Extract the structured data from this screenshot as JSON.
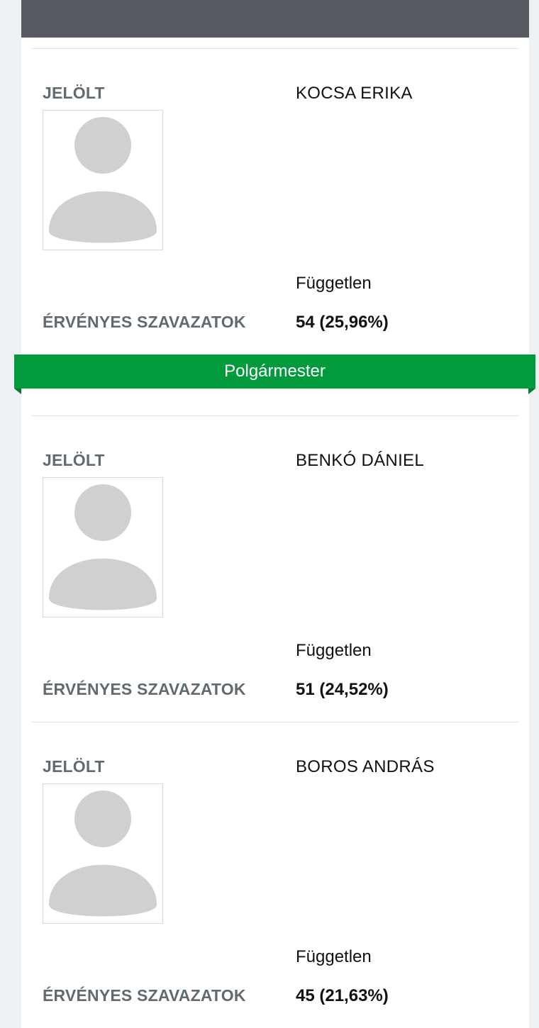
{
  "section_banner": "Polgármester",
  "labels": {
    "candidate": "JELÖLT",
    "valid_votes": "ÉRVÉNYES SZAVAZATOK"
  },
  "candidates": [
    {
      "name": "KOCSA ERIKA",
      "party": "Független",
      "votes": "54 (25,96%)"
    },
    {
      "name": "BENKÓ DÁNIEL",
      "party": "Független",
      "votes": "51 (24,52%)"
    },
    {
      "name": "BOROS ANDRÁS",
      "party": "Független",
      "votes": "45 (21,63%)"
    }
  ],
  "colors": {
    "banner": "#039a3e",
    "top_bar": "#555b61",
    "label": "#5f6b70",
    "placeholder": "#d0d0d0"
  },
  "icons": {
    "photo_placeholder": "avatar-placeholder-icon"
  }
}
